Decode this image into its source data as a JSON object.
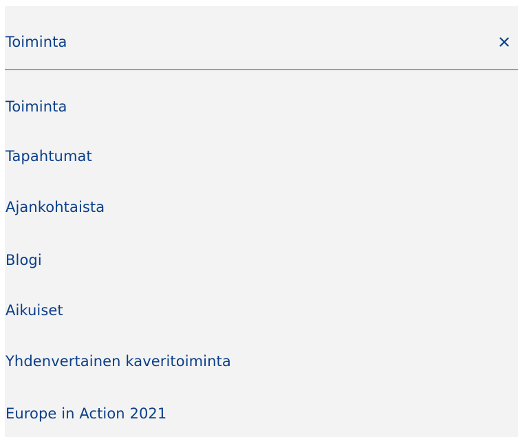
{
  "menu": {
    "title": "Toiminta",
    "close_icon": "close-icon",
    "accent_color": "#0b3f88",
    "divider_color": "#1f4e8c",
    "background_color": "#f3f3f3",
    "items": [
      {
        "label": "Toiminta"
      },
      {
        "label": "Tapahtumat"
      },
      {
        "label": "Ajankohtaista"
      },
      {
        "label": "Blogi"
      },
      {
        "label": "Aikuiset"
      },
      {
        "label": "Yhdenvertainen kaveritoiminta"
      },
      {
        "label": "Europe in Action 2021"
      }
    ]
  }
}
